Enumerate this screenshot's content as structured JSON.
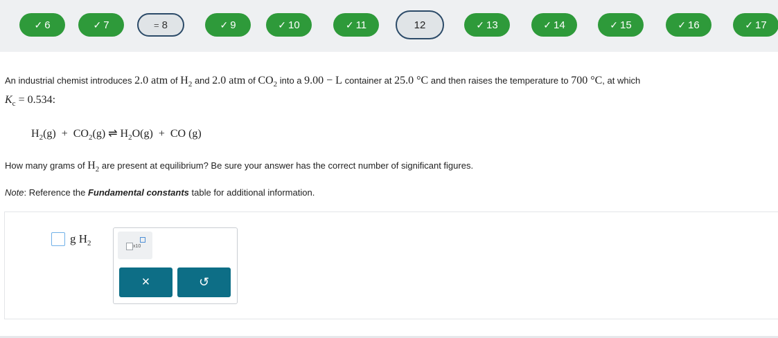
{
  "nav": {
    "items": [
      {
        "label": "6",
        "state": "done"
      },
      {
        "label": "7",
        "state": "done"
      },
      {
        "label": "8",
        "state": "partial"
      },
      {
        "label": "9",
        "state": "done"
      },
      {
        "label": "10",
        "state": "done"
      },
      {
        "label": "11",
        "state": "done"
      },
      {
        "label": "12",
        "state": "current"
      },
      {
        "label": "13",
        "state": "done"
      },
      {
        "label": "14",
        "state": "done"
      },
      {
        "label": "15",
        "state": "done"
      },
      {
        "label": "16",
        "state": "done"
      },
      {
        "label": "17",
        "state": "done"
      }
    ],
    "check_glyph": "✓",
    "partial_glyph": "=",
    "colors": {
      "done": "#2e9a3a",
      "current_border": "#2b4a68"
    }
  },
  "question": {
    "intro_1": "An industrial chemist introduces",
    "p_h2": "2.0 atm",
    "of_1": "of",
    "h2_main": "H",
    "h2_sub": "2",
    "and": "and",
    "p_co2": "2.0 atm",
    "of_2": "of",
    "co2_main": "CO",
    "co2_sub": "2",
    "into_a": "into a",
    "volume": "9.00 − L",
    "container_at": "container at",
    "t1": "25.0 °C",
    "then_raises": "and then raises the temperature to",
    "t2": "700 °C",
    "at_which": ", at which",
    "kc_main": "K",
    "kc_sub": "c",
    "kc_value": " = 0.534:",
    "eq_h2": "H",
    "eq_h2_sub": "2",
    "eq_g1": "(g)",
    "eq_plus1": "+",
    "eq_co2": "CO",
    "eq_co2_sub": "2",
    "eq_g2": "(g)",
    "eq_arrow": "⇌",
    "eq_h2o_h": "H",
    "eq_h2o_sub": "2",
    "eq_h2o_o": "O",
    "eq_g3": "(g)",
    "eq_plus2": "+",
    "eq_co": "CO",
    "eq_g4": "(g)",
    "ask_1": "How many grams of",
    "ask_h": "H",
    "ask_sub": "2",
    "ask_2": "are present at equilibrium? Be sure your answer has the correct number of significant figures.",
    "note_label": "Note",
    "note_1": ": Reference the",
    "note_bold": "Fundamental constants",
    "note_2": "table for additional information."
  },
  "answer": {
    "unit_g": "g",
    "unit_h": "H",
    "unit_sub": "2",
    "sci_x10": "x10",
    "clear_label": "×",
    "undo_label": "↺"
  }
}
